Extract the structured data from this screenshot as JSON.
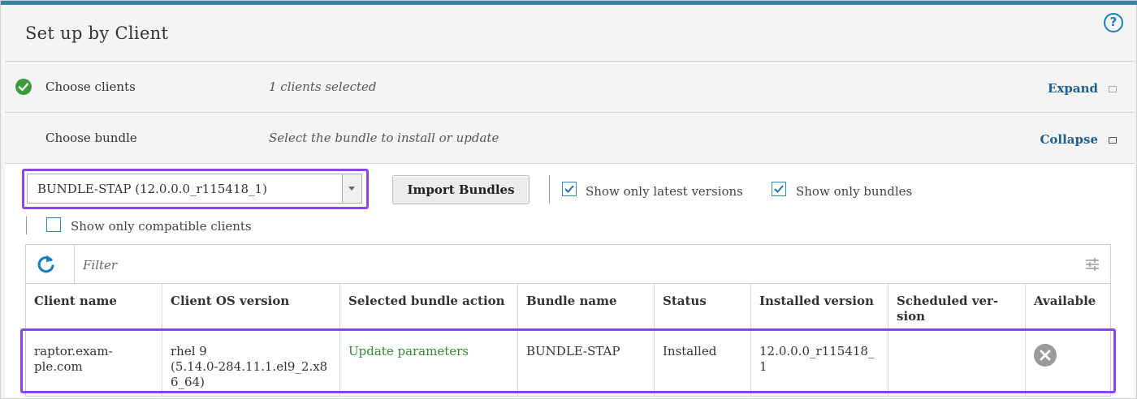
{
  "page": {
    "title": "Set up by Client",
    "help_symbol": "?"
  },
  "steps": {
    "clients": {
      "label": "Choose clients",
      "value": "1 clients selected",
      "action": "Expand",
      "status": "complete"
    },
    "bundle": {
      "label": "Choose bundle",
      "value": "Select the bundle to install or update",
      "action": "Collapse"
    }
  },
  "bundle_controls": {
    "selected_bundle": "BUNDLE-STAP (12.0.0.0_r115418_1)",
    "import_button": "Import Bundles",
    "show_latest_label": "Show only latest versions",
    "show_latest_checked": true,
    "show_bundles_label": "Show only bundles",
    "show_bundles_checked": true,
    "show_compatible_label": "Show only compatible clients",
    "show_compatible_checked": false
  },
  "table": {
    "filter_placeholder": "Filter",
    "columns": [
      "Client name",
      "Client OS version",
      "Selected bundle action",
      "Bundle name",
      "Status",
      "Installed version",
      "Scheduled ver-\nsion",
      "Available"
    ],
    "rows": [
      {
        "client_name": "raptor.exam-\nple.com",
        "os_version": "rhel 9\n(5.14.0-284.11.1.el9_2.x8\n6_64)",
        "action": "Update parameters",
        "bundle_name": "BUNDLE-STAP",
        "status": "Installed",
        "installed_version": "12.0.0.0_r115418_\n1",
        "scheduled_version": "",
        "available_icon": "remove-circle-icon"
      }
    ]
  },
  "colors": {
    "accent": "#3a83a6",
    "link": "#1d5f8f",
    "action_green": "#2d8a2d",
    "highlight": "#8a44f0",
    "success": "#3c9a3c"
  }
}
